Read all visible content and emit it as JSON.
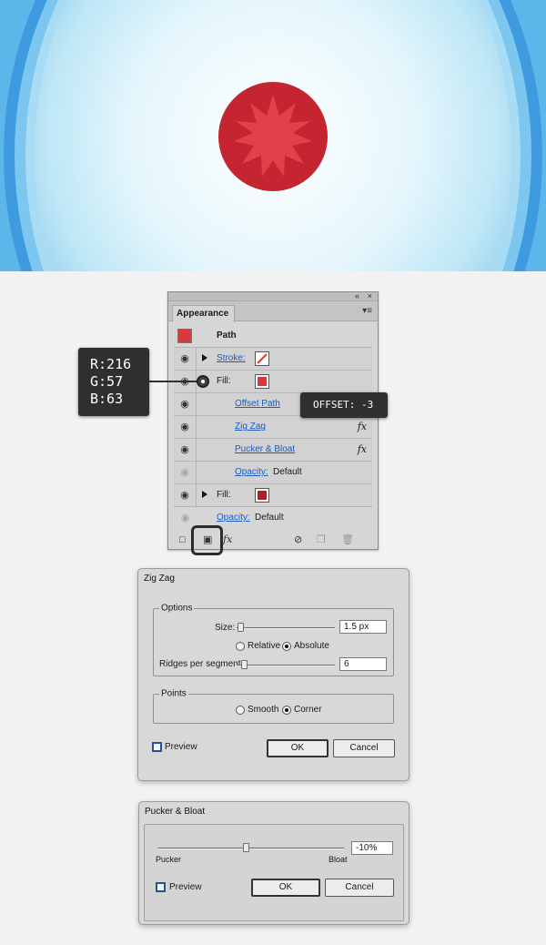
{
  "appearance_panel": {
    "tab": "Appearance",
    "path_label": "Path",
    "rows": [
      {
        "label": "Stroke:"
      },
      {
        "label": "Fill:"
      },
      {
        "label": "Offset Path"
      },
      {
        "label": "Zig Zag"
      },
      {
        "label": "Pucker & Bloat"
      },
      {
        "label": "Opacity:",
        "value": "Default"
      },
      {
        "label": "Fill:"
      },
      {
        "label": "Opacity:",
        "value": "Default"
      }
    ],
    "fx_label": "fx",
    "footer_fx": "fx"
  },
  "callouts": {
    "rgb": [
      "R:216",
      "G:57",
      "B:63"
    ],
    "offset": "OFFSET: -3"
  },
  "zigzag": {
    "title": "Zig Zag",
    "options_title": "Options",
    "size_label": "Size:",
    "size_value": "1.5 px",
    "relative": "Relative",
    "absolute": "Absolute",
    "ridges_label": "Ridges per segment:",
    "ridges_value": "6",
    "points_title": "Points",
    "smooth": "Smooth",
    "corner": "Corner",
    "preview": "Preview",
    "ok": "OK",
    "cancel": "Cancel"
  },
  "pucker": {
    "title": "Pucker & Bloat",
    "value": "-10%",
    "pucker_label": "Pucker",
    "bloat_label": "Bloat",
    "preview": "Preview",
    "ok": "OK",
    "cancel": "Cancel"
  },
  "colors": {
    "fill_red": "#d8393f",
    "fill_dark_red": "#b01e28",
    "link_blue": "#1a5bc4"
  }
}
